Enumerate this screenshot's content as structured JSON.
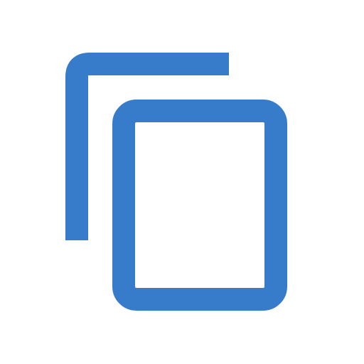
{
  "icon": {
    "name": "copy-icon",
    "color": "#377CCA",
    "background": "#FFFFFF"
  }
}
